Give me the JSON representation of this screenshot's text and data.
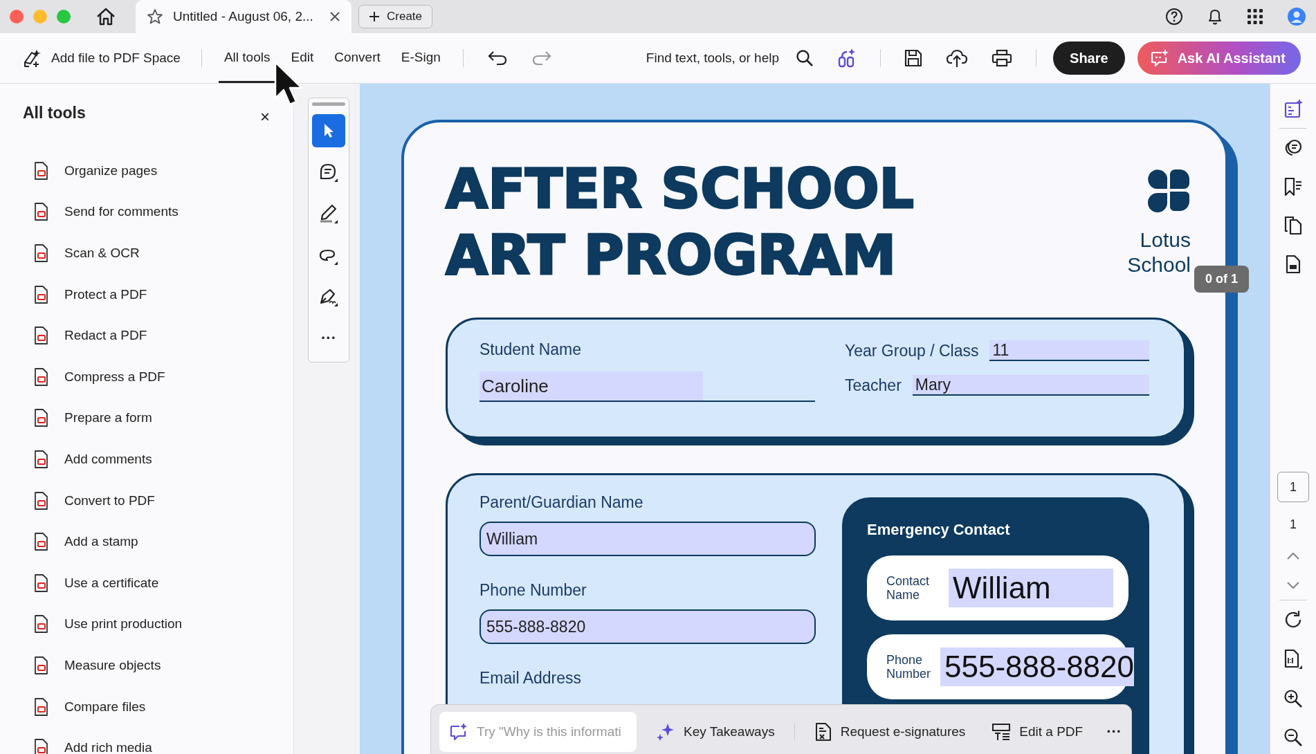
{
  "window": {
    "tab_title": "Untitled - August 06, 2...",
    "create_button": "Create"
  },
  "toolbar": {
    "add_file": "Add file to PDF Space",
    "tabs": [
      {
        "label": "All tools",
        "selected": true
      },
      {
        "label": "Edit",
        "selected": false
      },
      {
        "label": "Convert",
        "selected": false
      },
      {
        "label": "E-Sign",
        "selected": false
      }
    ],
    "search_label": "Find text, tools, or help",
    "share_button": "Share",
    "ai_button": "Ask AI Assistant"
  },
  "tools_panel": {
    "title": "All tools",
    "close": "×",
    "items": [
      "Organize pages",
      "Send for comments",
      "Scan & OCR",
      "Protect a PDF",
      "Redact a PDF",
      "Compress a PDF",
      "Prepare a form",
      "Add comments",
      "Convert to PDF",
      "Add a stamp",
      "Use a certificate",
      "Use print production",
      "Measure objects",
      "Compare files",
      "Add rich media"
    ]
  },
  "quick_tools": {
    "more": "···"
  },
  "document": {
    "title_lines": [
      "AFTER SCHOOL",
      "ART PROGRAM"
    ],
    "school_lines": [
      "Lotus",
      "School"
    ],
    "student": {
      "name_label": "Student Name",
      "name_value": "Caroline",
      "year_label": "Year Group / Class",
      "year_value": "11",
      "teacher_label": "Teacher",
      "teacher_value": "Mary"
    },
    "guardian": {
      "name_label": "Parent/Guardian Name",
      "name_value": "William",
      "phone_label": "Phone Number",
      "phone_value": "555-888-8820",
      "email_label": "Email Address"
    },
    "emergency": {
      "title": "Emergency Contact",
      "contact_label": "Contact Name",
      "contact_value": "William",
      "phone_label": "Phone Number",
      "phone_value": "555-888-8820"
    }
  },
  "page_tooltip": "0 of 1",
  "page_nav": {
    "current": "1",
    "total": "1"
  },
  "prompt_bar": {
    "placeholder": "Try \"Why is this informati",
    "actions": [
      "Key Takeaways",
      "Request e-signatures",
      "Edit a PDF"
    ],
    "more": "···"
  }
}
